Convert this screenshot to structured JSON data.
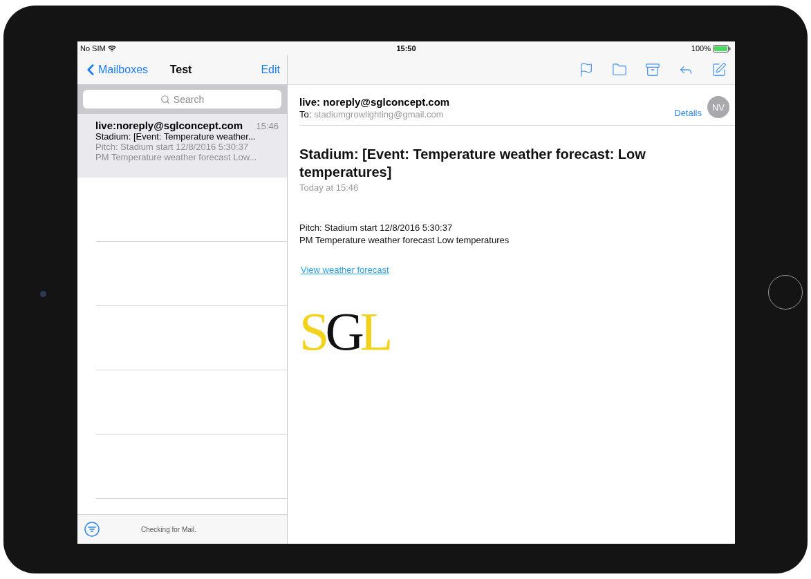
{
  "status_bar": {
    "carrier": "No SIM",
    "time": "15:50",
    "battery": "100%"
  },
  "mailbox_nav": {
    "back": "Mailboxes",
    "title": "Test",
    "action": "Edit"
  },
  "search": {
    "placeholder": "Search"
  },
  "messages": [
    {
      "sender": "live:noreply@sglconcept.com",
      "time": "15:46",
      "subject": "Stadium: [Event: Temperature weather...",
      "preview": [
        "Pitch: Stadium start 12/8/2016 5:30:37",
        "PM Temperature weather forecast Low..."
      ],
      "selected": true
    }
  ],
  "list_footer": {
    "status": "Checking for Mail."
  },
  "message": {
    "from": "live: noreply@sglconcept.com",
    "to_label": "To:",
    "to": "stadiumgrowlighting@gmail.com",
    "details": "Details",
    "avatar": "NV",
    "subject": "Stadium: [Event: Temperature weather forecast: Low temperatures]",
    "date": "Today at 15:46",
    "body": [
      "Pitch: Stadium start 12/8/2016 5:30:37",
      "PM Temperature weather forecast Low temperatures"
    ],
    "link": "View weather forecast",
    "logo": "SGL"
  }
}
